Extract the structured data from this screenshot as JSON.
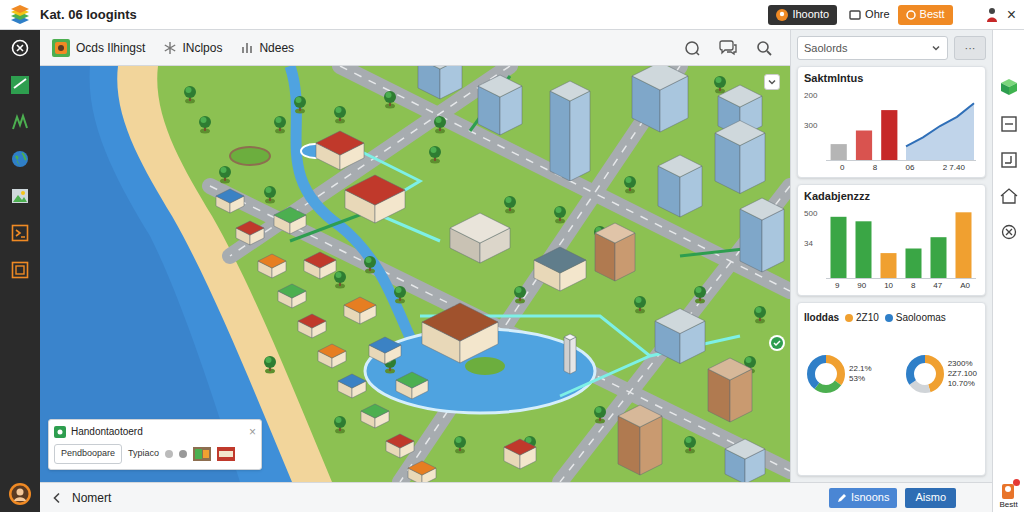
{
  "app": {
    "title": "Kat. 06 loogints"
  },
  "top_bar": {
    "user": "Ihoonto",
    "link": "Ohre",
    "button": "Bestt",
    "close": "×"
  },
  "toolbar": {
    "items": [
      "Ocds Ilhingst",
      "INclpos",
      "Ndees"
    ]
  },
  "map_overlay": {
    "title": "Handontaotoerd",
    "close": "×",
    "field": "Pendboopare",
    "type": "Typiaco"
  },
  "panel": {
    "search": {
      "value": "Saolords",
      "more": "···"
    },
    "bar_charts": [
      {
        "title": "Saktmlntus",
        "ticks": [
          "200",
          "300"
        ],
        "bars": [
          {
            "value": 70,
            "color": "#b5b5b5"
          },
          {
            "value": 130,
            "color": "#d9534f"
          },
          {
            "value": 220,
            "color": "#c62828"
          }
        ],
        "line": {
          "values": [
            60,
            100,
            150,
            190,
            250
          ],
          "color": "#2f6fb8"
        },
        "labels": [
          "0",
          "8",
          "06",
          "2 7.40"
        ]
      },
      {
        "title": "Kadabjenzzz",
        "ticks": [
          "500",
          "34"
        ],
        "bars": [
          {
            "value": 270,
            "color": "#3aa645"
          },
          {
            "value": 250,
            "color": "#3aa645"
          },
          {
            "value": 110,
            "color": "#f0a030"
          },
          {
            "value": 130,
            "color": "#3aa645"
          },
          {
            "value": 180,
            "color": "#3aa645"
          },
          {
            "value": 290,
            "color": "#f0a030"
          }
        ],
        "labels": [
          "9",
          "90",
          "10",
          "8",
          "47",
          "A0"
        ]
      }
    ],
    "donut_card": {
      "title": "Iloddas",
      "legend": [
        {
          "label": "2Z10",
          "color": "#f0a030"
        },
        {
          "label": "Saoloomas",
          "color": "#2f7fc8"
        }
      ],
      "donuts": [
        {
          "segments": [
            {
              "value": 35,
              "color": "#f0a030"
            },
            {
              "value": 25,
              "color": "#4caf50"
            },
            {
              "value": 40,
              "color": "#2f7fc8"
            }
          ],
          "labels": [
            "22.1%",
            "53%"
          ]
        },
        {
          "segments": [
            {
              "value": 45,
              "color": "#f0a030"
            },
            {
              "value": 20,
              "color": "#d0d4d8"
            },
            {
              "value": 35,
              "color": "#2f7fc8"
            }
          ],
          "labels": [
            "2300%",
            "2Z7.100",
            "10.70%"
          ]
        }
      ]
    }
  },
  "bottom_bar": {
    "back": "Nomert",
    "buttons": [
      "Isnoons",
      "Aismo"
    ]
  },
  "rail": {
    "label": "Bestt"
  }
}
